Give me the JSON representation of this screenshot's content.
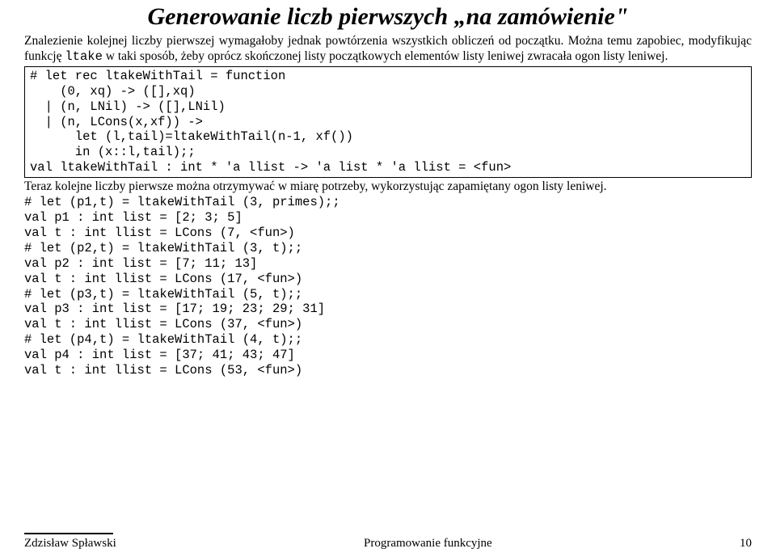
{
  "title": "Generowanie liczb pierwszych „na zamówienie\"",
  "para1_a": "Znalezienie kolejnej liczby pierwszej wymagałoby jednak powtórzenia wszystkich obliczeń od początku. Można temu zapobiec, modyfikując funkcję ",
  "para1_code": "ltake",
  "para1_b": " w taki sposób, żeby oprócz skończonej listy początkowych elementów listy leniwej zwracała ogon listy leniwej.",
  "code1": "# let rec ltakeWithTail = function\n    (0, xq) -> ([],xq)\n  | (n, LNil) -> ([],LNil)\n  | (n, LCons(x,xf)) ->\n      let (l,tail)=ltakeWithTail(n-1, xf())\n      in (x::l,tail);;\nval ltakeWithTail : int * 'a llist -> 'a list * 'a llist = <fun>",
  "para2": "Teraz kolejne liczby pierwsze można otrzymywać w miarę potrzeby, wykorzystując zapamiętany ogon listy leniwej.",
  "code2": "# let (p1,t) = ltakeWithTail (3, primes);;\nval p1 : int list = [2; 3; 5]\nval t : int llist = LCons (7, <fun>)\n# let (p2,t) = ltakeWithTail (3, t);;\nval p2 : int list = [7; 11; 13]\nval t : int llist = LCons (17, <fun>)\n# let (p3,t) = ltakeWithTail (5, t);;\nval p3 : int list = [17; 19; 23; 29; 31]\nval t : int llist = LCons (37, <fun>)\n# let (p4,t) = ltakeWithTail (4, t);;\nval p4 : int list = [37; 41; 43; 47]\nval t : int llist = LCons (53, <fun>)",
  "footer": {
    "left": "Zdzisław Spławski",
    "center": "Programowanie funkcyjne",
    "right": "10"
  }
}
